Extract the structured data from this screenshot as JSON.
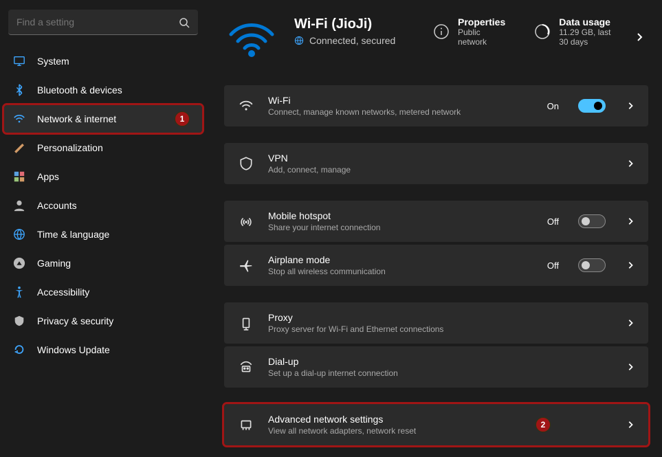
{
  "search": {
    "placeholder": "Find a setting"
  },
  "sidebar": {
    "items": [
      {
        "label": "System",
        "icon": "monitor-icon"
      },
      {
        "label": "Bluetooth & devices",
        "icon": "bluetooth-icon"
      },
      {
        "label": "Network & internet",
        "icon": "wifi-icon"
      },
      {
        "label": "Personalization",
        "icon": "brush-icon"
      },
      {
        "label": "Apps",
        "icon": "apps-icon"
      },
      {
        "label": "Accounts",
        "icon": "person-icon"
      },
      {
        "label": "Time & language",
        "icon": "globe-clock-icon"
      },
      {
        "label": "Gaming",
        "icon": "gaming-icon"
      },
      {
        "label": "Accessibility",
        "icon": "accessibility-icon"
      },
      {
        "label": "Privacy & security",
        "icon": "shield-icon"
      },
      {
        "label": "Windows Update",
        "icon": "update-icon"
      }
    ]
  },
  "annotations": {
    "sidebar_badge": "1",
    "card_badge": "2"
  },
  "header": {
    "title": "Wi-Fi (JioJi)",
    "status": "Connected, secured",
    "properties": {
      "title": "Properties",
      "sub": "Public network"
    },
    "usage": {
      "title": "Data usage",
      "sub": "11.29 GB, last 30 days"
    }
  },
  "cards": [
    {
      "icon": "wifi-icon",
      "title": "Wi-Fi",
      "sub": "Connect, manage known networks, metered network",
      "toggle": "on",
      "status": "On"
    },
    {
      "icon": "shield-outline-icon",
      "title": "VPN",
      "sub": "Add, connect, manage"
    },
    {
      "icon": "hotspot-icon",
      "title": "Mobile hotspot",
      "sub": "Share your internet connection",
      "toggle": "off",
      "status": "Off"
    },
    {
      "icon": "airplane-icon",
      "title": "Airplane mode",
      "sub": "Stop all wireless communication",
      "toggle": "off",
      "status": "Off"
    },
    {
      "icon": "proxy-icon",
      "title": "Proxy",
      "sub": "Proxy server for Wi-Fi and Ethernet connections"
    },
    {
      "icon": "dialup-icon",
      "title": "Dial-up",
      "sub": "Set up a dial-up internet connection"
    },
    {
      "icon": "adapter-icon",
      "title": "Advanced network settings",
      "sub": "View all network adapters, network reset"
    }
  ]
}
